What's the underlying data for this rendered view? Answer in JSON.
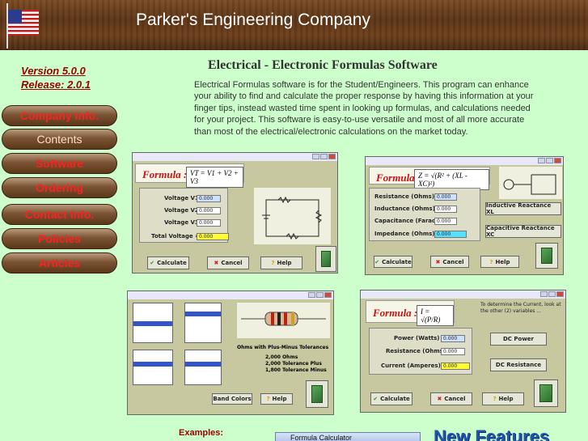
{
  "header": {
    "title": "Parker's Engineering Company",
    "flag_icon": "us-flag-icon"
  },
  "sidebar": {
    "version": "Version 5.0.0",
    "release": "Release: 2.0.1",
    "items": [
      {
        "label": "Company Info."
      },
      {
        "label": "Contents"
      },
      {
        "label": "Software"
      },
      {
        "label": "Ordering"
      },
      {
        "label": "Contact Info."
      },
      {
        "label": "Policies"
      },
      {
        "label": "Articles"
      }
    ]
  },
  "main": {
    "title": "Electrical - Electronic Formulas Software",
    "intro": "Electrical Formulas software is for the Student/Engineers. This program can enhance your ability to find and calculate the proper response by having this information at your finger tips, instead  wasted time spent in looking up formulas, and calculations needed for your project. This software is easy-to-use versatile and most of all more accurate than most of the electrical/electronic calculations on the market today."
  },
  "screens": {
    "voltage": {
      "formula_label": "Formula :",
      "formula": "VT = V1 + V2 + V3",
      "fields": [
        "Voltage V1 :",
        "Voltage V2 :",
        "Voltage V3 :",
        "Total Voltage ="
      ],
      "values": [
        "0.000",
        "0.000",
        "0.000",
        "0.000"
      ],
      "buttons": [
        "Calculate",
        "Cancel",
        "Help"
      ]
    },
    "impedance": {
      "formula_label": "Formula :",
      "formula": "Z = √(R² + (XL - XC)²)",
      "fields": [
        "Resistance (Ohms) :",
        "Inductance (Ohms) :",
        "Capacitance (Farads) :",
        "Impedance (Ohms) ="
      ],
      "values": [
        "0.000",
        "0.000",
        "0.000",
        "0.000"
      ],
      "side_buttons": [
        "Inductive Reactance XL",
        "Capacitive Reactance XC"
      ],
      "buttons": [
        "Calculate",
        "Cancel",
        "Help"
      ]
    },
    "resistor": {
      "buttons": [
        "Band Colors",
        "Help"
      ],
      "note": "Ohms with Plus-Minus Tolerances",
      "tolerances": [
        "2,000 Ohms",
        "2,000 Tolerance Plus",
        "1,800 Tolerance Minus"
      ]
    },
    "current": {
      "formula_label": "Formula :",
      "formula": "I = √(P/R)",
      "caption": "To determine the Current, look at the other (2) variables ...",
      "fields": [
        "Power (Watts) :",
        "Resistance (Ohms) :",
        "Current (Amperes) ="
      ],
      "values": [
        "0.000",
        "0.000",
        "0.000"
      ],
      "side_buttons": [
        "DC Power",
        "DC Resistance"
      ],
      "buttons": [
        "Calculate",
        "Cancel",
        "Help"
      ]
    }
  },
  "footer": {
    "examples": "Examples:",
    "formula_calculator": "Formula Calculator",
    "new_features": "New Features"
  }
}
